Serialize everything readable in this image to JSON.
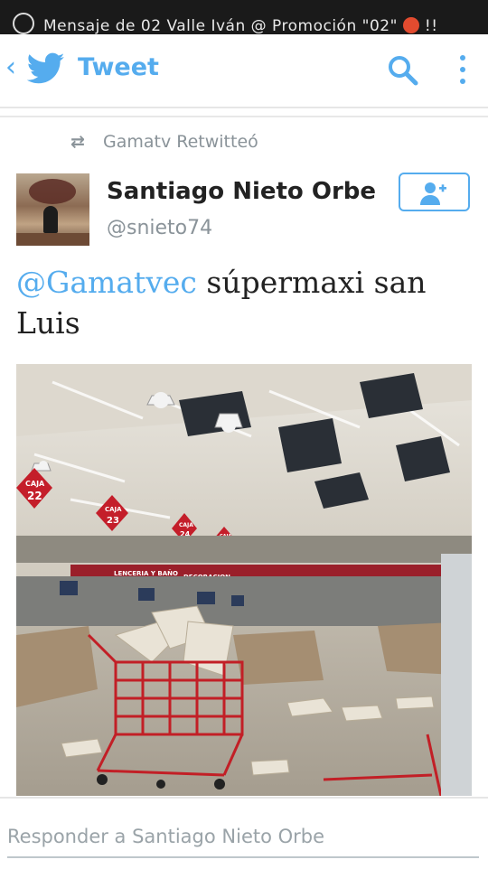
{
  "status_bar": {
    "notification": "Mensaje de 02 Valle Iván @ Promoción \"02\"",
    "suffix": "!!"
  },
  "header": {
    "title": "Tweet",
    "back_icon": "back-chevron-icon",
    "logo_icon": "twitter-bird-icon",
    "search_icon": "search-icon",
    "more_icon": "more-vertical-icon"
  },
  "tweet": {
    "retweet_label": "Gamatv Retwitteó",
    "author_name": "Santiago Nieto Orbe",
    "author_handle": "@snieto74",
    "mention": "@Gamatvec",
    "text": " súpermaxi san Luis"
  },
  "reply": {
    "placeholder": "Responder a Santiago Nieto Orbe"
  },
  "colors": {
    "accent": "#55acee",
    "text": "#222222",
    "muted": "#8a9399"
  }
}
